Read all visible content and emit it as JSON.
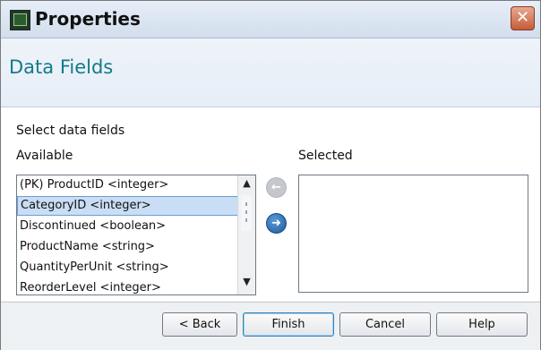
{
  "window": {
    "title": "Properties",
    "close_glyph": "✕",
    "app_icon": "app-icon",
    "close_icon": "close-icon"
  },
  "header": {
    "title": "Data Fields"
  },
  "form": {
    "instruction": "Select data fields",
    "available_label": "Available",
    "selected_label": "Selected",
    "available_items": [
      {
        "label": "(PK) ProductID <integer>",
        "selected": false
      },
      {
        "label": "CategoryID <integer>",
        "selected": true
      },
      {
        "label": "Discontinued <boolean>",
        "selected": false
      },
      {
        "label": "ProductName <string>",
        "selected": false
      },
      {
        "label": "QuantityPerUnit <string>",
        "selected": false
      },
      {
        "label": "ReorderLevel <integer>",
        "selected": false
      }
    ],
    "selected_items": [],
    "remove_glyph": "←",
    "add_glyph": "➜",
    "scroll_up_glyph": "▲",
    "scroll_down_glyph": "▼"
  },
  "buttons": {
    "back": "< Back",
    "finish": "Finish",
    "cancel": "Cancel",
    "help": "Help"
  },
  "colors": {
    "header_title": "#147a8a",
    "selection_bg": "#c9def5",
    "close_button": "#c45b3b",
    "add_button": "#1f5a9c",
    "remove_button_disabled": "#c4c8cc"
  }
}
